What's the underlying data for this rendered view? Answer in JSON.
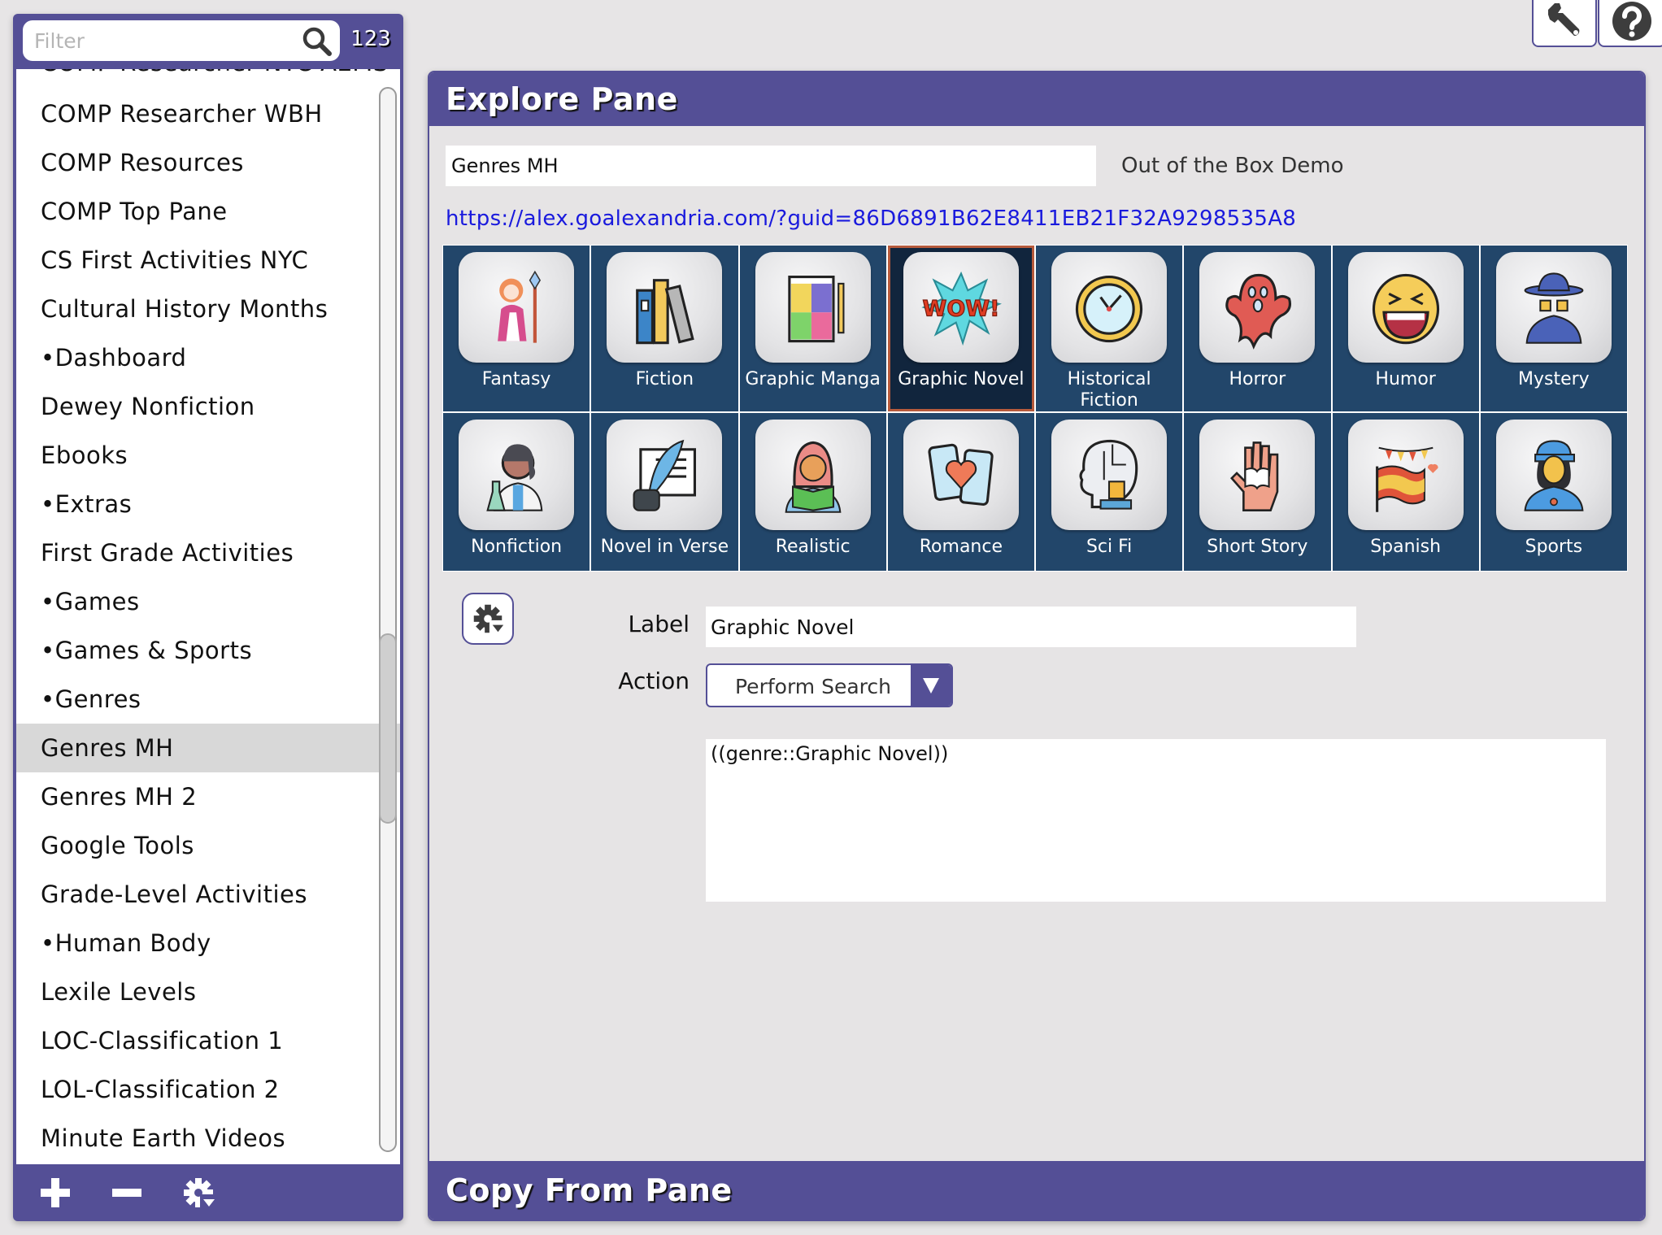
{
  "sidebar": {
    "filter_placeholder": "Filter",
    "filter_value": "",
    "count": "123",
    "items": [
      {
        "label": "COMP Researcher NYC AEMS",
        "partial": true
      },
      {
        "label": "COMP Researcher WBH"
      },
      {
        "label": "COMP Resources"
      },
      {
        "label": "COMP Top Pane"
      },
      {
        "label": "CS First Activities NYC"
      },
      {
        "label": "Cultural History Months"
      },
      {
        "label": "•Dashboard"
      },
      {
        "label": "Dewey Nonfiction"
      },
      {
        "label": "Ebooks"
      },
      {
        "label": "•Extras"
      },
      {
        "label": "First Grade Activities"
      },
      {
        "label": "•Games"
      },
      {
        "label": "•Games & Sports"
      },
      {
        "label": "•Genres"
      },
      {
        "label": "Genres MH",
        "selected": true
      },
      {
        "label": "Genres MH 2"
      },
      {
        "label": "Google Tools"
      },
      {
        "label": "Grade-Level Activities"
      },
      {
        "label": "•Human Body"
      },
      {
        "label": "Lexile Levels"
      },
      {
        "label": "LOC-Classification 1"
      },
      {
        "label": "LOL-Classification 2"
      },
      {
        "label": "Minute Earth Videos"
      }
    ],
    "footer_icons": [
      "plus-icon",
      "minus-icon",
      "gear-menu-icon"
    ]
  },
  "top_buttons": [
    "wrench-icon",
    "help-icon"
  ],
  "explore": {
    "title": "Explore Pane",
    "name_value": "Genres MH",
    "owner": "Out of the Box Demo",
    "url": "https://alex.goalexandria.com/?guid=86D6891B62E8411EB21F32A9298535A8",
    "tiles": [
      {
        "label": "Fantasy",
        "icon": "fantasy-icon"
      },
      {
        "label": "Fiction",
        "icon": "books-icon"
      },
      {
        "label": "Graphic Manga",
        "icon": "manga-icon"
      },
      {
        "label": "Graphic Novel",
        "icon": "wow-icon",
        "selected": true
      },
      {
        "label": "Historical Fiction",
        "icon": "clock-icon"
      },
      {
        "label": "Horror",
        "icon": "ghost-icon"
      },
      {
        "label": "Humor",
        "icon": "laughing-face-icon"
      },
      {
        "label": "Mystery",
        "icon": "detective-icon"
      },
      {
        "label": "Nonfiction",
        "icon": "scientist-icon"
      },
      {
        "label": "Novel in Verse",
        "icon": "quill-icon"
      },
      {
        "label": "Realistic",
        "icon": "reader-icon"
      },
      {
        "label": "Romance",
        "icon": "phones-heart-icon"
      },
      {
        "label": "Sci Fi",
        "icon": "robot-head-icon"
      },
      {
        "label": "Short Story",
        "icon": "hand-book-icon"
      },
      {
        "label": "Spanish",
        "icon": "spain-flag-icon"
      },
      {
        "label": "Sports",
        "icon": "coach-icon"
      }
    ],
    "form": {
      "label_caption": "Label",
      "label_value": "Graphic Novel",
      "action_caption": "Action",
      "action_value": "Perform Search",
      "query_value": "((genre::Graphic Novel))"
    }
  },
  "copy_from": {
    "title": "Copy From Pane"
  },
  "colors": {
    "brand_purple": "#544f96",
    "tile_blue": "#22466a",
    "tile_selected": "#11253d",
    "selected_outline": "#b65a3c",
    "link_blue": "#1a1add"
  }
}
